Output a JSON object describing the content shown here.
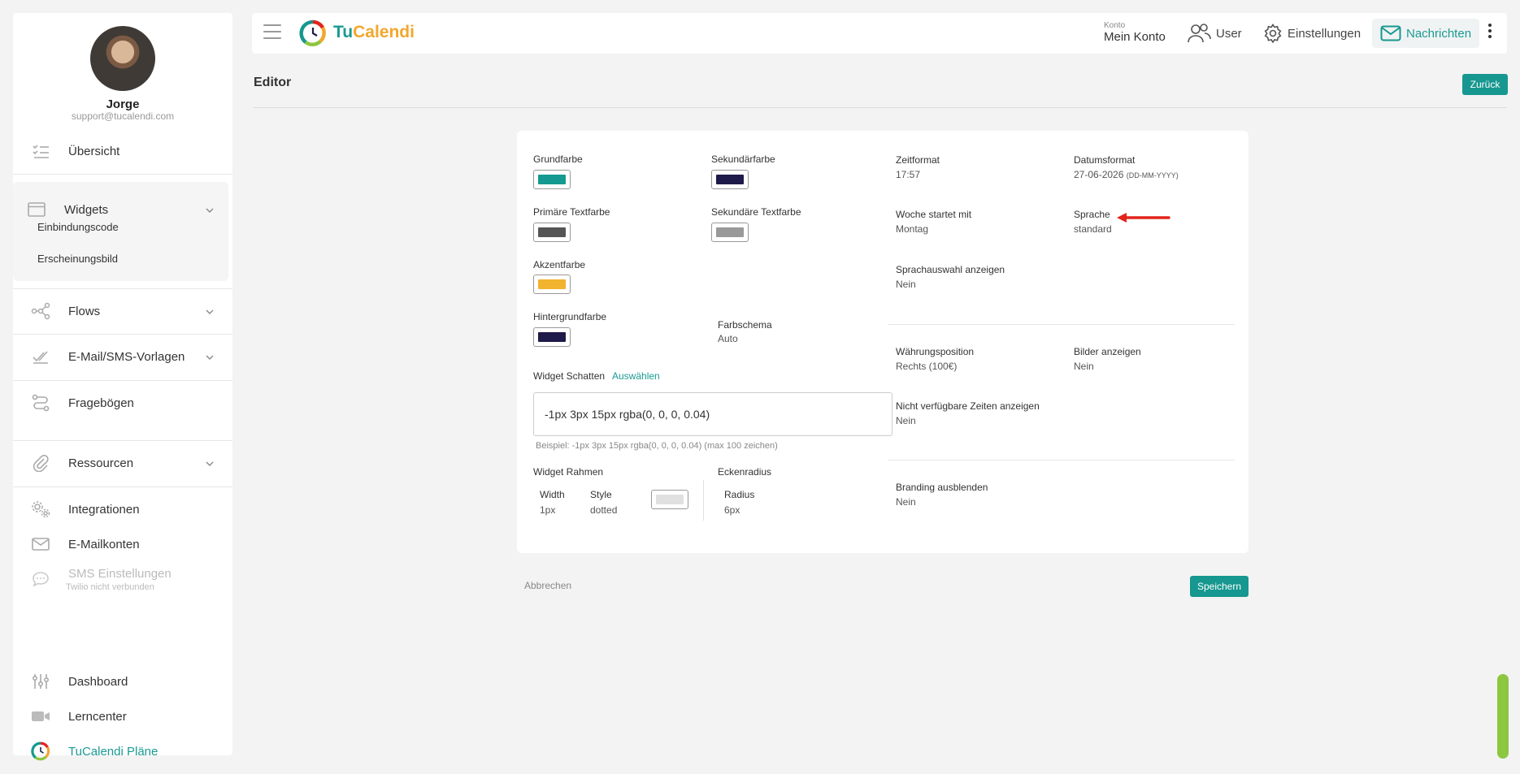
{
  "profile": {
    "name": "Jorge",
    "email": "support@tucalendi.com"
  },
  "sidebar": {
    "overview": "Übersicht",
    "widgets": "Widgets",
    "widgets_sub": [
      "Einbindungscode",
      "Erscheinungsbild"
    ],
    "flows": "Flows",
    "templates": "E-Mail/SMS-Vorlagen",
    "questionnaires": "Fragebögen",
    "resources": "Ressourcen",
    "integrations": "Integrationen",
    "email_accounts": "E-Mailkonten",
    "sms_settings": "SMS Einstellungen",
    "sms_status": "Twilio nicht verbunden",
    "dashboard": "Dashboard",
    "learning": "Lerncenter",
    "plans": "TuCalendi Pläne"
  },
  "topbar": {
    "logo_tu": "Tu",
    "logo_cal": "Calendi",
    "account_small": "Konto",
    "account_big": "Mein Konto",
    "user": "User",
    "settings": "Einstellungen",
    "messages": "Nachrichten"
  },
  "page": {
    "title": "Editor",
    "back": "Zurück"
  },
  "colors": {
    "primary": {
      "label": "Grundfarbe",
      "value": "#149a90"
    },
    "secondary": {
      "label": "Sekundärfarbe",
      "value": "#1e1a4a"
    },
    "primary_text": {
      "label": "Primäre Textfarbe",
      "value": "#555555"
    },
    "secondary_text": {
      "label": "Sekundäre Textfarbe",
      "value": "#999999"
    },
    "accent": {
      "label": "Akzentfarbe",
      "value": "#f2b32e"
    },
    "background": {
      "label": "Hintergrundfarbe",
      "value": "#1e1a4a"
    }
  },
  "scheme": {
    "label": "Farbschema",
    "value": "Auto"
  },
  "shadow": {
    "label": "Widget Schatten",
    "link": "Auswählen",
    "value": "-1px 3px 15px rgba(0, 0, 0, 0.04)",
    "hint": "Beispiel: -1px 3px 15px rgba(0, 0, 0, 0.04) (max 100 zeichen)"
  },
  "border": {
    "label": "Widget Rahmen",
    "width_label": "Width",
    "width_value": "1px",
    "style_label": "Style",
    "style_value": "dotted",
    "color": "#e0e0e0"
  },
  "corner": {
    "label": "Eckenradius",
    "radius_label": "Radius",
    "radius_value": "6px"
  },
  "settings": {
    "time_format": {
      "label": "Zeitformat",
      "value": "17:57"
    },
    "date_format": {
      "label": "Datumsformat",
      "value": "27-06-2026",
      "hint": "(DD-MM-YYYY)"
    },
    "week_start": {
      "label": "Woche startet mit",
      "value": "Montag"
    },
    "language": {
      "label": "Sprache",
      "value": "standard"
    },
    "show_language": {
      "label": "Sprachauswahl anzeigen",
      "value": "Nein"
    },
    "currency_pos": {
      "label": "Währungsposition",
      "value": "Rechts (100€)"
    },
    "show_images": {
      "label": "Bilder anzeigen",
      "value": "Nein"
    },
    "show_unavailable": {
      "label": "Nicht verfügbare Zeiten anzeigen",
      "value": "Nein"
    },
    "hide_branding": {
      "label": "Branding ausblenden",
      "value": "Nein"
    }
  },
  "actions": {
    "cancel": "Abbrechen",
    "save": "Speichern"
  },
  "theme": {
    "accent": "#16978f",
    "logo_orange": "#f2a72e",
    "annotation_arrow": "#e3231b"
  }
}
